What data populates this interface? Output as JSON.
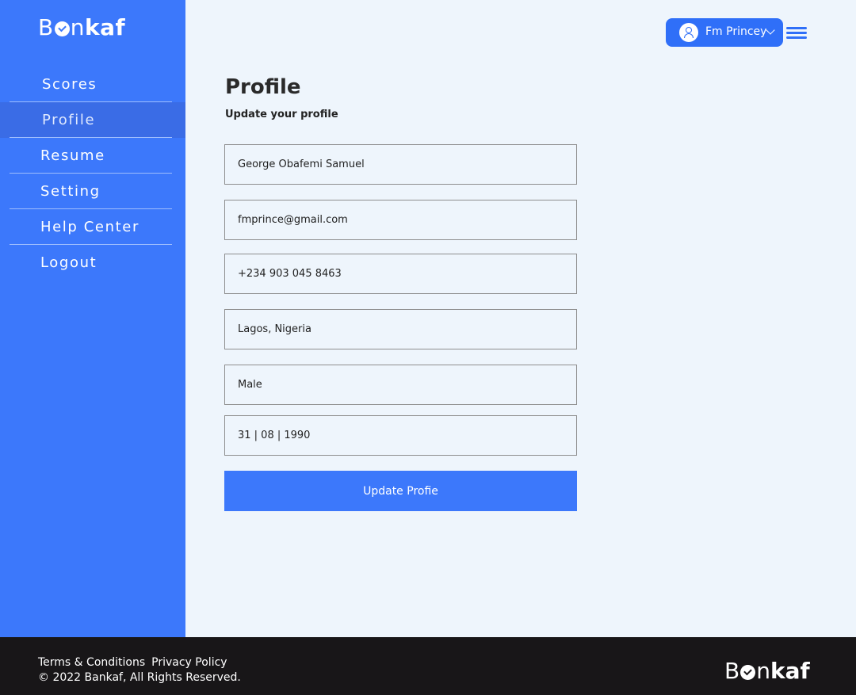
{
  "brand": {
    "name_part1": "B",
    "name_part2": "n",
    "name_part3": "kaf"
  },
  "sidebar": {
    "items": [
      {
        "label": "Scores"
      },
      {
        "label": "Profile"
      },
      {
        "label": "Resume"
      },
      {
        "label": "Setting"
      },
      {
        "label": "Help Center"
      },
      {
        "label": "Logout"
      }
    ],
    "active": "Profile"
  },
  "header": {
    "user_name": "Fm Princey"
  },
  "main": {
    "title": "Profile",
    "subtitle": "Update your profile",
    "fields": [
      {
        "value": "George Obafemi Samuel"
      },
      {
        "value": "fmprince@gmail.com"
      },
      {
        "value": "+234 903 045 8463"
      },
      {
        "value": "Lagos, Nigeria"
      },
      {
        "value": "Male"
      },
      {
        "value": "31 | 08 | 1990"
      }
    ],
    "submit_label": "Update Profie"
  },
  "footer": {
    "terms": "Terms & Conditions",
    "privacy": "Privacy Policy",
    "copyright": "© 2022 Bankaf, All Rights Reserved."
  },
  "colors": {
    "primary": "#3c78fb",
    "footer_bg": "#181618",
    "page_bg": "#eef5fc"
  }
}
